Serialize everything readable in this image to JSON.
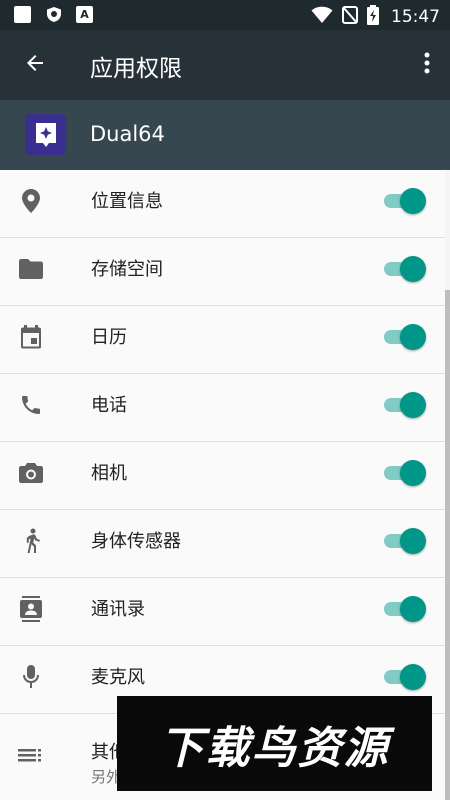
{
  "status_bar": {
    "time": "15:47",
    "icons": [
      "square-notification-icon",
      "shield-icon",
      "a-icon",
      "wifi-icon",
      "no-sim-icon",
      "battery-charging-icon"
    ],
    "a_label": "A"
  },
  "app_bar": {
    "title": "应用权限",
    "back_icon": "arrow-left-icon",
    "more_icon": "more-vertical-icon"
  },
  "app_header": {
    "name": "Dual64",
    "icon": "dual64-app-icon"
  },
  "permissions": [
    {
      "label": "位置信息",
      "icon": "location-icon",
      "enabled": true
    },
    {
      "label": "存储空间",
      "icon": "folder-icon",
      "enabled": true
    },
    {
      "label": "日历",
      "icon": "calendar-icon",
      "enabled": true
    },
    {
      "label": "电话",
      "icon": "phone-icon",
      "enabled": true
    },
    {
      "label": "相机",
      "icon": "camera-icon",
      "enabled": true
    },
    {
      "label": "身体传感器",
      "icon": "walking-icon",
      "enabled": true
    },
    {
      "label": "通讯录",
      "icon": "contacts-icon",
      "enabled": true
    },
    {
      "label": "麦克风",
      "icon": "microphone-icon",
      "enabled": true
    }
  ],
  "other_permissions": {
    "label": "其他",
    "subtitle": "另外",
    "icon": "list-icon"
  },
  "watermark": {
    "text": "下载鸟资源"
  },
  "colors": {
    "status_bar": "#1f2a2f",
    "app_bar": "#263238",
    "app_header": "#37474f",
    "accent": "#009688",
    "accent_track": "#80cbc4",
    "app_icon_bg": "#3a2e8f"
  }
}
